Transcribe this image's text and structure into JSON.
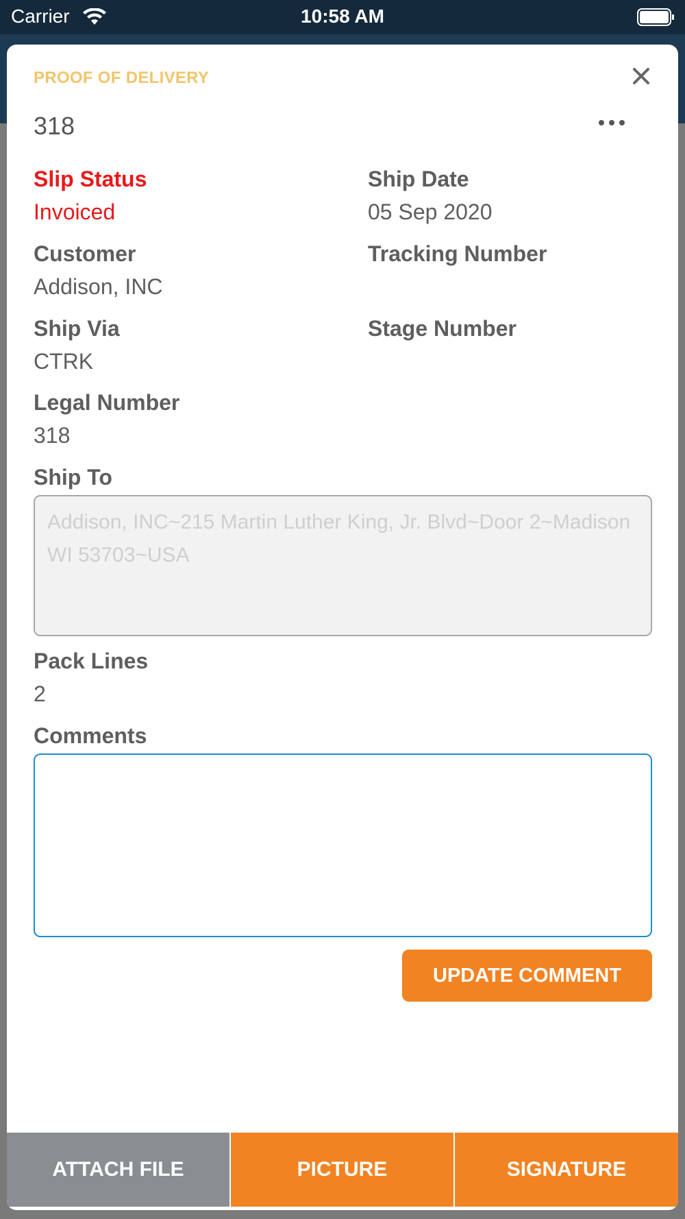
{
  "status_bar": {
    "carrier": "Carrier",
    "time": "10:58 AM"
  },
  "sheet": {
    "title": "PROOF OF DELIVERY",
    "record_number": "318"
  },
  "fields": {
    "slip_status": {
      "label": "Slip Status",
      "value": "Invoiced"
    },
    "ship_date": {
      "label": "Ship Date",
      "value": "05 Sep 2020"
    },
    "customer": {
      "label": "Customer",
      "value": "Addison, INC"
    },
    "tracking_number": {
      "label": "Tracking Number",
      "value": ""
    },
    "ship_via": {
      "label": "Ship Via",
      "value": "CTRK"
    },
    "stage_number": {
      "label": "Stage Number",
      "value": ""
    },
    "legal_number": {
      "label": "Legal Number",
      "value": "318"
    },
    "ship_to": {
      "label": "Ship To",
      "value": "Addison, INC~215 Martin Luther King, Jr. Blvd~Door 2~Madison WI 53703~USA"
    },
    "pack_lines": {
      "label": "Pack Lines",
      "value": "2"
    },
    "comments": {
      "label": "Comments",
      "value": ""
    }
  },
  "actions": {
    "update_comment": "UPDATE COMMENT",
    "attach_file": "ATTACH FILE",
    "picture": "PICTURE",
    "signature": "SIGNATURE"
  },
  "icons": {
    "close": "close-icon",
    "more": "more-icon",
    "wifi": "wifi-icon",
    "battery": "battery-icon"
  },
  "colors": {
    "accent": "#f28322",
    "title": "#f2c56b",
    "status_red": "#e8191b",
    "focus_blue": "#1a8cd8",
    "secondary_button": "#8a8d92"
  }
}
